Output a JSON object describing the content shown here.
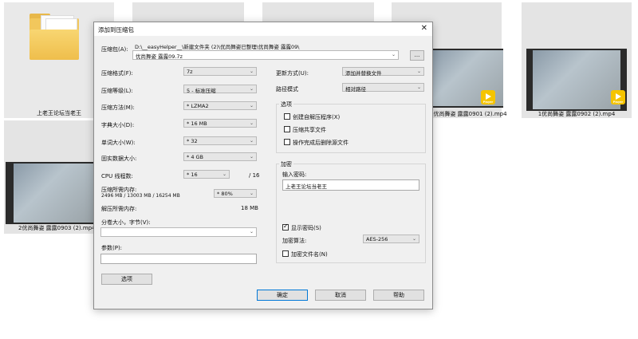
{
  "desktop": {
    "files": [
      {
        "label": "上老王论坛当老王"
      },
      {
        "label": "2优尚舞姿 露露0903 (2).mp4"
      },
      {
        "label": "2优尚舞姿 露露0901 (2).mp4"
      },
      {
        "label": "1优尚舞姿 露露0902 (2).mp4"
      }
    ],
    "player_badge": "Player"
  },
  "dialog": {
    "title": "添加到压缩包",
    "archive_label": "压缩包(A):",
    "archive_path": "D:\\__easyHelper__\\新建文件夹 (2)\\优尚舞姿已整理\\优尚舞姿 露露09\\",
    "archive_name": "优尚舞姿 露露09.7z",
    "browse_label": "...",
    "format_label": "压缩格式(F):",
    "format_value": "7z",
    "level_label": "压缩等级(L):",
    "level_value": "5 - 标准压缩",
    "method_label": "压缩方法(M):",
    "method_value": "* LZMA2",
    "dict_label": "字典大小(D):",
    "dict_value": "* 16 MB",
    "word_label": "单词大小(W):",
    "word_value": "* 32",
    "solid_label": "固实数据大小:",
    "solid_value": "* 4 GB",
    "cpu_label": "CPU 线程数:",
    "cpu_value": "* 16",
    "cpu_total": "/ 16",
    "mem_comp_label": "压缩所需内存:",
    "mem_comp_detail": "2496 MB / 13003 MB / 16254 MB",
    "mem_comp_value": "* 80%",
    "mem_decomp_label": "解压所需内存:",
    "mem_decomp_value": "18 MB",
    "split_label": "分卷大小，字节(V):",
    "split_value": "",
    "params_label": "参数(P):",
    "params_value": "",
    "options_button": "选项",
    "update_label": "更新方式(U):",
    "update_value": "添加并替换文件",
    "path_label": "路径模式",
    "path_value": "相对路径",
    "options_group": "选项",
    "opt_sfx": "创建自解压程序(X)",
    "opt_shared": "压缩共享文件",
    "opt_delete": "操作完成后删除源文件",
    "encrypt_group": "加密",
    "password_label": "输入密码:",
    "password_value": "上老王论坛当老王",
    "show_password": "显示密码(S)",
    "enc_method_label": "加密算法:",
    "enc_method_value": "AES-256",
    "enc_names": "加密文件名(N)",
    "ok_button": "确定",
    "cancel_button": "取消",
    "help_button": "帮助"
  }
}
